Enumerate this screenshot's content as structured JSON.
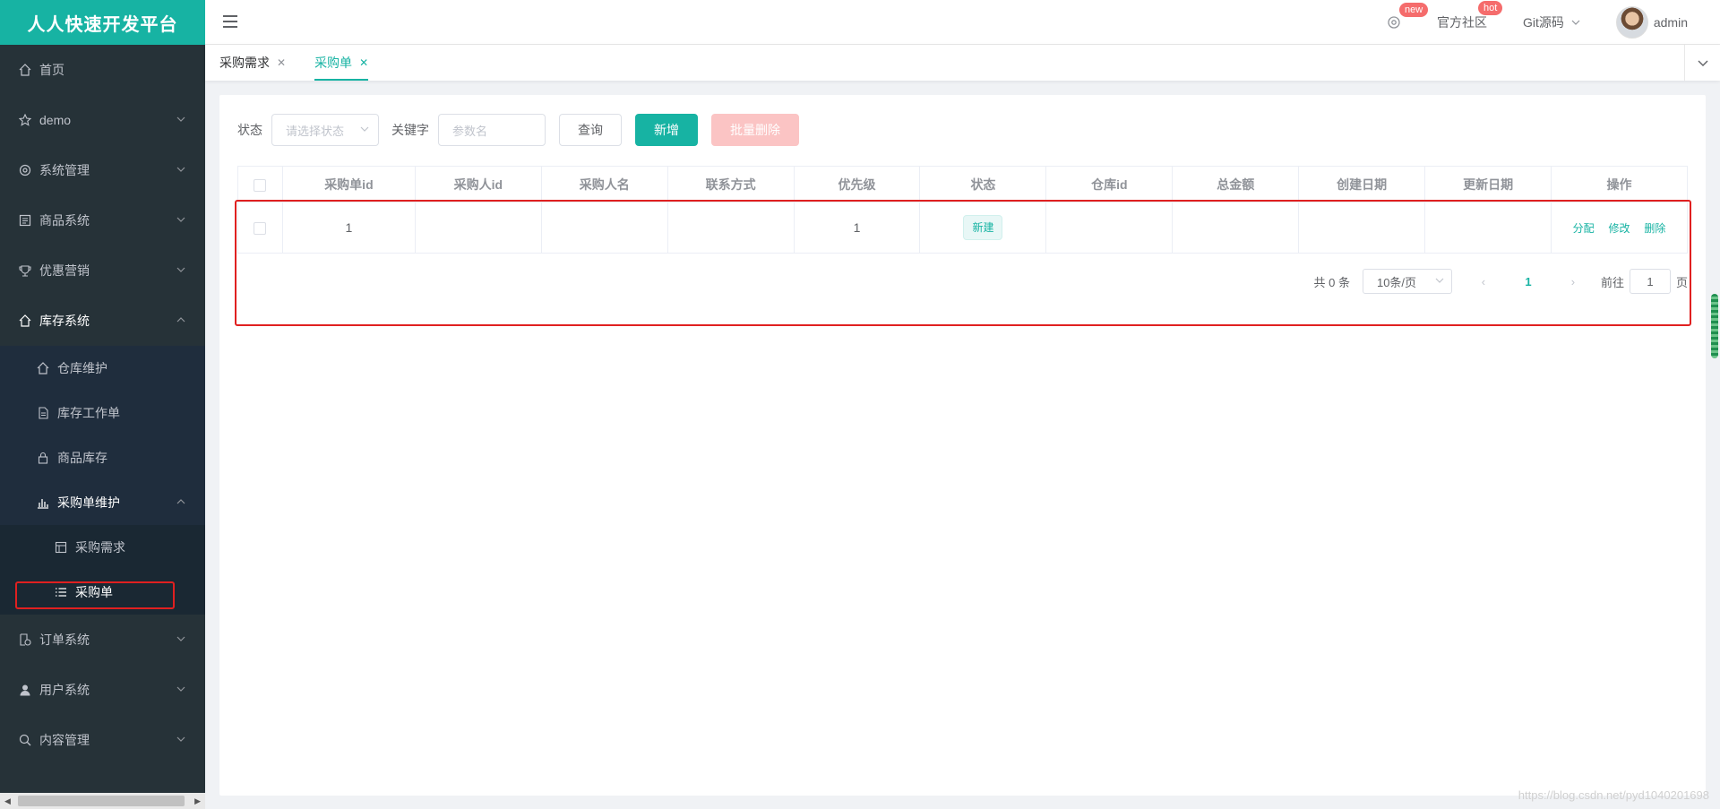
{
  "brand": "人人快速开发平台",
  "sidebar": {
    "items": [
      {
        "label": "首页"
      },
      {
        "label": "demo"
      },
      {
        "label": "系统管理"
      },
      {
        "label": "商品系统"
      },
      {
        "label": "优惠营销"
      },
      {
        "label": "库存系统"
      },
      {
        "label": "订单系统"
      },
      {
        "label": "用户系统"
      },
      {
        "label": "内容管理"
      }
    ],
    "inventory_sub": [
      {
        "label": "仓库维护"
      },
      {
        "label": "库存工作单"
      },
      {
        "label": "商品库存"
      },
      {
        "label": "采购单维护"
      }
    ],
    "purchase_sub": [
      {
        "label": "采购需求"
      },
      {
        "label": "采购单"
      }
    ]
  },
  "header": {
    "badge_new": "new",
    "community": "官方社区",
    "badge_hot": "hot",
    "git": "Git源码",
    "user": "admin"
  },
  "tabs": [
    {
      "label": "采购需求"
    },
    {
      "label": "采购单"
    }
  ],
  "toolbar": {
    "status_label": "状态",
    "status_placeholder": "请选择状态",
    "keyword_label": "关键字",
    "keyword_placeholder": "参数名",
    "query": "查询",
    "add": "新增",
    "batch_delete": "批量删除"
  },
  "table": {
    "columns": [
      "采购单id",
      "采购人id",
      "采购人名",
      "联系方式",
      "优先级",
      "状态",
      "仓库id",
      "总金额",
      "创建日期",
      "更新日期",
      "操作"
    ],
    "rows": [
      {
        "id": "1",
        "buyer_id": "",
        "buyer_name": "",
        "phone": "",
        "priority": "1",
        "status": "新建",
        "ware_id": "",
        "amount": "",
        "created": "",
        "updated": ""
      }
    ],
    "ops": {
      "assign": "分配",
      "edit": "修改",
      "delete": "删除"
    }
  },
  "pager": {
    "total": "共 0 条",
    "page_size": "10条/页",
    "current": "1",
    "goto_label": "前往",
    "goto_value": "1",
    "page_suffix": "页"
  },
  "watermark": "https://blog.csdn.net/pyd1040201698"
}
